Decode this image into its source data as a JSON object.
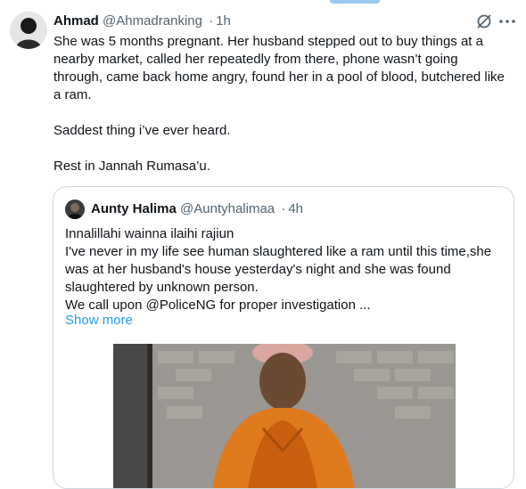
{
  "tweet": {
    "author_name": "Ahmad",
    "author_handle": "@Ahmadranking",
    "separator": "·",
    "time": "1h",
    "paragraphs": [
      "She was 5 months pregnant. Her husband stepped out to buy things at a nearby market, called her repeatedly from there, phone wasn’t going through, came back home angry, found her in a pool of blood, butchered like a ram.",
      "Saddest thing i’ve ever heard.",
      "Rest in Jannah Rumasa’u."
    ],
    "icons": [
      "grok-icon",
      "more-icon"
    ]
  },
  "quoted_tweet": {
    "author_name": "Aunty Halima",
    "author_handle": "@Auntyhalimaa",
    "separator": "·",
    "time": "4h",
    "lines": [
      "Innalillahi wainna ilaihi rajiun",
      "I've never in my life see human slaughtered like a ram until this time,she was at her husband's house yesterday's night and she was found slaughtered by unknown person.",
      "We call upon @PoliceNG for proper investigation ..."
    ],
    "show_more": "Show more"
  },
  "colors": {
    "text": "#0f1419",
    "secondary": "#536471",
    "link": "#1d9bf0",
    "border": "#cfd9de"
  }
}
